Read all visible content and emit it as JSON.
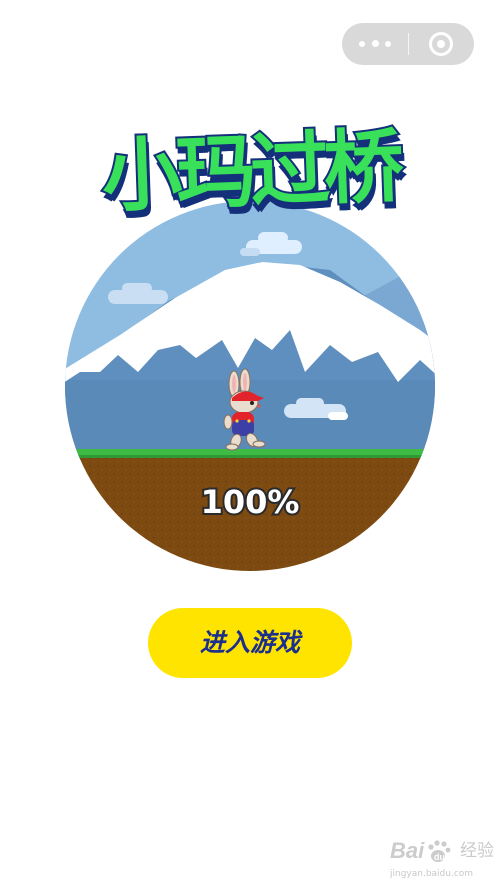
{
  "menu_capsule": {
    "more_icon": "more-dots-icon",
    "close_icon": "close-target-icon"
  },
  "game": {
    "title": "小玛过桥",
    "character": "rabbit-runner",
    "scene": {
      "sky_color": "#8fbde2",
      "mountain_color": "#5f8fbe",
      "snow_color": "#ffffff",
      "grass_color": "#3dbb45",
      "ground_color": "#7d4a12"
    },
    "loading_progress": 1.0,
    "loading_label": "100%",
    "enter_button_label": "进入游戏",
    "accent_color": "#ffe400",
    "title_color": "#39e05a",
    "outline_color": "#14307a"
  },
  "watermark": {
    "logo_text": "Bai",
    "word": "经验",
    "url": "jingyan.baidu.com"
  }
}
